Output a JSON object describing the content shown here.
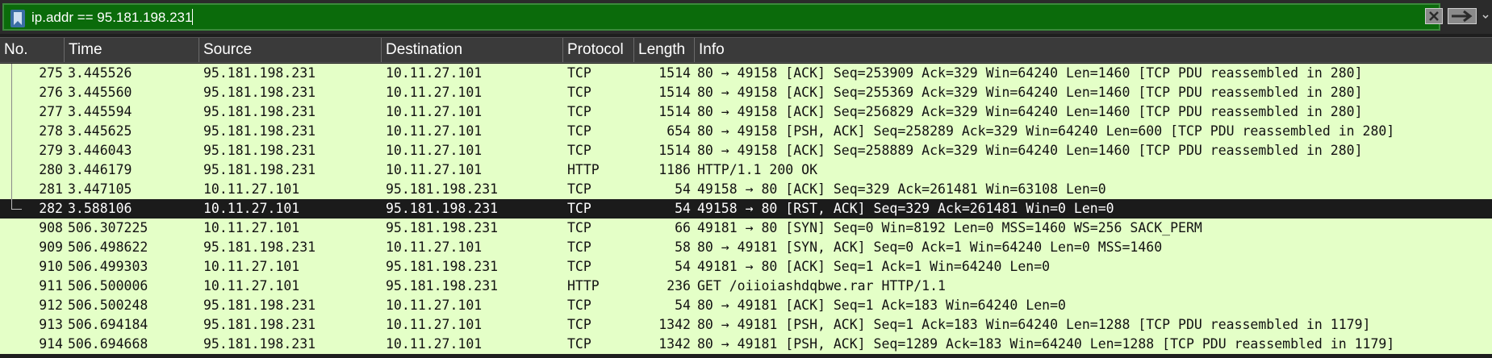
{
  "filter": {
    "expression": "ip.addr == 95.181.198.231"
  },
  "columns": [
    "No.",
    "Time",
    "Source",
    "Destination",
    "Protocol",
    "Length",
    "Info"
  ],
  "icons": {
    "bookmark": "bookmark-icon",
    "clear": "clear-filter-icon",
    "apply": "apply-filter-arrow-icon",
    "dropdown": "dropdown-icon"
  },
  "colors": {
    "filter_valid_bg": "#0b6b0b",
    "row_bg": "#e4ffc7",
    "selected_row_bg": "#1b1b1b"
  },
  "packets": [
    {
      "no": "275",
      "time": "3.445526",
      "src": "95.181.198.231",
      "dst": "10.11.27.101",
      "proto": "TCP",
      "len": "1514",
      "info": "80 → 49158 [ACK] Seq=253909 Ack=329 Win=64240 Len=1460 [TCP PDU reassembled in 280]"
    },
    {
      "no": "276",
      "time": "3.445560",
      "src": "95.181.198.231",
      "dst": "10.11.27.101",
      "proto": "TCP",
      "len": "1514",
      "info": "80 → 49158 [ACK] Seq=255369 Ack=329 Win=64240 Len=1460 [TCP PDU reassembled in 280]"
    },
    {
      "no": "277",
      "time": "3.445594",
      "src": "95.181.198.231",
      "dst": "10.11.27.101",
      "proto": "TCP",
      "len": "1514",
      "info": "80 → 49158 [ACK] Seq=256829 Ack=329 Win=64240 Len=1460 [TCP PDU reassembled in 280]"
    },
    {
      "no": "278",
      "time": "3.445625",
      "src": "95.181.198.231",
      "dst": "10.11.27.101",
      "proto": "TCP",
      "len": "654",
      "info": "80 → 49158 [PSH, ACK] Seq=258289 Ack=329 Win=64240 Len=600 [TCP PDU reassembled in 280]"
    },
    {
      "no": "279",
      "time": "3.446043",
      "src": "95.181.198.231",
      "dst": "10.11.27.101",
      "proto": "TCP",
      "len": "1514",
      "info": "80 → 49158 [ACK] Seq=258889 Ack=329 Win=64240 Len=1460 [TCP PDU reassembled in 280]"
    },
    {
      "no": "280",
      "time": "3.446179",
      "src": "95.181.198.231",
      "dst": "10.11.27.101",
      "proto": "HTTP",
      "len": "1186",
      "info": "HTTP/1.1 200 OK"
    },
    {
      "no": "281",
      "time": "3.447105",
      "src": "10.11.27.101",
      "dst": "95.181.198.231",
      "proto": "TCP",
      "len": "54",
      "info": "49158 → 80 [ACK] Seq=329 Ack=261481 Win=63108 Len=0"
    },
    {
      "no": "282",
      "time": "3.588106",
      "src": "10.11.27.101",
      "dst": "95.181.198.231",
      "proto": "TCP",
      "len": "54",
      "info": "49158 → 80 [RST, ACK] Seq=329 Ack=261481 Win=0 Len=0",
      "selected": true
    },
    {
      "no": "908",
      "time": "506.307225",
      "src": "10.11.27.101",
      "dst": "95.181.198.231",
      "proto": "TCP",
      "len": "66",
      "info": "49181 → 80 [SYN] Seq=0 Win=8192 Len=0 MSS=1460 WS=256 SACK_PERM"
    },
    {
      "no": "909",
      "time": "506.498622",
      "src": "95.181.198.231",
      "dst": "10.11.27.101",
      "proto": "TCP",
      "len": "58",
      "info": "80 → 49181 [SYN, ACK] Seq=0 Ack=1 Win=64240 Len=0 MSS=1460"
    },
    {
      "no": "910",
      "time": "506.499303",
      "src": "10.11.27.101",
      "dst": "95.181.198.231",
      "proto": "TCP",
      "len": "54",
      "info": "49181 → 80 [ACK] Seq=1 Ack=1 Win=64240 Len=0"
    },
    {
      "no": "911",
      "time": "506.500006",
      "src": "10.11.27.101",
      "dst": "95.181.198.231",
      "proto": "HTTP",
      "len": "236",
      "info": "GET /oiioiashdqbwe.rar HTTP/1.1"
    },
    {
      "no": "912",
      "time": "506.500248",
      "src": "95.181.198.231",
      "dst": "10.11.27.101",
      "proto": "TCP",
      "len": "54",
      "info": "80 → 49181 [ACK] Seq=1 Ack=183 Win=64240 Len=0"
    },
    {
      "no": "913",
      "time": "506.694184",
      "src": "95.181.198.231",
      "dst": "10.11.27.101",
      "proto": "TCP",
      "len": "1342",
      "info": "80 → 49181 [PSH, ACK] Seq=1 Ack=183 Win=64240 Len=1288 [TCP PDU reassembled in 1179]"
    },
    {
      "no": "914",
      "time": "506.694668",
      "src": "95.181.198.231",
      "dst": "10.11.27.101",
      "proto": "TCP",
      "len": "1342",
      "info": "80 → 49181 [PSH, ACK] Seq=1289 Ack=183 Win=64240 Len=1288 [TCP PDU reassembled in 1179]"
    }
  ]
}
